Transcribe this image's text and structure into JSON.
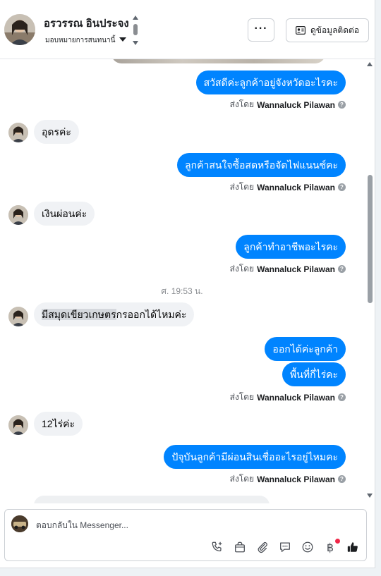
{
  "header": {
    "contact_name": "อรวรรณ อินประจง",
    "assign_label": "มอบหมายการสนทนานี้",
    "more_label": "···",
    "contact_info_label": "ดูข้อมูลติดต่อ"
  },
  "messages": [
    {
      "dir": "out",
      "text": "สวัสดีค่ะลูกค้าอยู่จังหวัดอะไรคะ"
    },
    {
      "sent_by_prefix": "ส่งโดย",
      "sent_by_name": "Wannaluck Pilawan"
    },
    {
      "dir": "in",
      "text": "อุดรค่ะ"
    },
    {
      "dir": "out",
      "text": "ลูกค้าสนใจซื้อสดหรือจัดไฟแนนซ์คะ"
    },
    {
      "sent_by_prefix": "ส่งโดย",
      "sent_by_name": "Wannaluck Pilawan"
    },
    {
      "dir": "in",
      "text": "เงินผ่อนค่ะ"
    },
    {
      "dir": "out",
      "text": "ลูกค้าทำอาชีพอะไรคะ"
    },
    {
      "sent_by_prefix": "ส่งโดย",
      "sent_by_name": "Wannaluck Pilawan"
    },
    {
      "timestamp": "ศ. 19:53 น."
    },
    {
      "dir": "in",
      "text_pre": "มีสมุดเขียวเกษตร",
      "text_post": "กรออกได้ไหมค่ะ"
    },
    {
      "dir": "out",
      "text": "ออกได้ค่ะลูกค้า"
    },
    {
      "dir": "out",
      "text": "พื้นที่กี่ไร่คะ"
    },
    {
      "sent_by_prefix": "ส่งโดย",
      "sent_by_name": "Wannaluck Pilawan"
    },
    {
      "dir": "in",
      "text": "12ไร่ค่ะ"
    },
    {
      "dir": "out",
      "text": "ปัจุบันลูกค้ามีผ่อนสินเชื่ออะไรอยู่ไหมคะ"
    },
    {
      "sent_by_prefix": "ส่งโดย",
      "sent_by_name": "Wannaluck Pilawan"
    }
  ],
  "composer": {
    "placeholder": "ตอบกลับใน Messenger...",
    "tool_icons": [
      "phone-plus-icon",
      "shopping-bag-icon",
      "paperclip-icon",
      "chat-bubble-icon",
      "smiley-icon",
      "baht-icon",
      "thumbs-up-icon"
    ],
    "baht_symbol": "฿"
  },
  "colors": {
    "outgoing_bubble": "#0084ff",
    "incoming_bubble": "#f0f2f5",
    "notification_dot": "#f02849"
  }
}
